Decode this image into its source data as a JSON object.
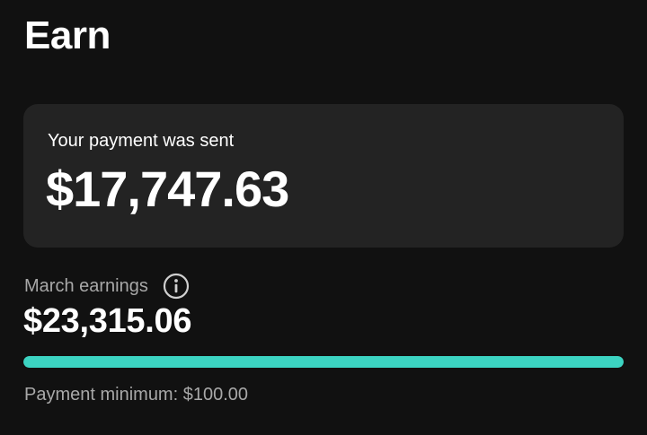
{
  "header": {
    "title": "Earn"
  },
  "payment_card": {
    "label": "Your payment was sent",
    "amount": "$17,747.63"
  },
  "earnings": {
    "label": "March earnings",
    "info_icon": "info-icon",
    "amount": "$23,315.06",
    "progress_fraction": 1.0,
    "minimum_text": "Payment minimum: $100.00"
  },
  "colors": {
    "background": "#111111",
    "card": "#232323",
    "accent": "#3cd4c2",
    "muted_text": "#a8a8a8"
  }
}
